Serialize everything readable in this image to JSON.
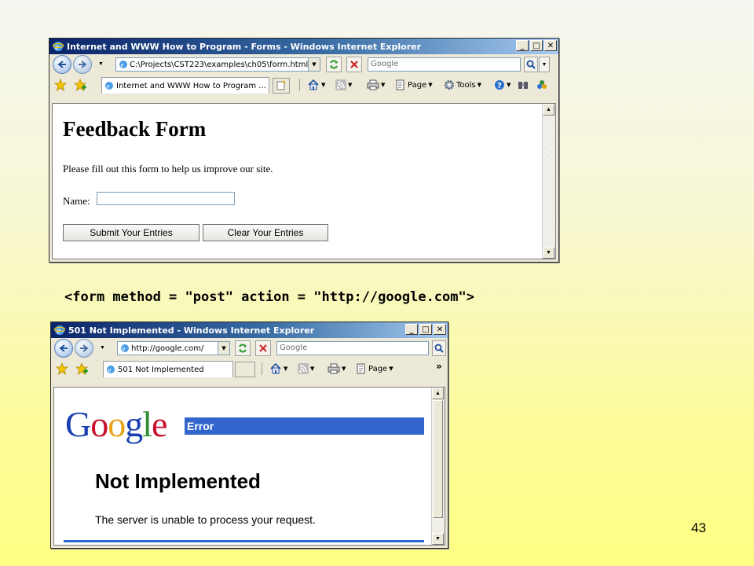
{
  "window1": {
    "title": "Internet and WWW How to Program - Forms - Windows Internet Explorer",
    "address": "C:\\Projects\\CST223\\examples\\ch05\\form.html",
    "search_placeholder": "Google",
    "tab_label": "Internet and WWW How to Program ...",
    "cmd_page": "Page",
    "cmd_tools": "Tools",
    "page": {
      "heading": "Feedback Form",
      "intro": "Please fill out this form to help us improve our site.",
      "name_label": "Name:",
      "name_value": "",
      "submit_label": "Submit Your Entries",
      "clear_label": "Clear Your Entries"
    }
  },
  "code_line": "<form method = \"post\" action = \"http://google.com\">",
  "window2": {
    "title": "501 Not Implemented - Windows Internet Explorer",
    "address": "http://google.com/",
    "search_placeholder": "Google",
    "tab_label": "501 Not Implemented",
    "cmd_page": "Page",
    "page": {
      "logo_letters": [
        "G",
        "o",
        "o",
        "g",
        "l",
        "e"
      ],
      "logo_colors": [
        "#1a3fb0",
        "#c8102e",
        "#e8a317",
        "#1a3fb0",
        "#2e8b2e",
        "#c8102e"
      ],
      "error_label": "Error",
      "heading": "Not Implemented",
      "message": "The server is unable to process your request."
    }
  },
  "slide_number": "43"
}
